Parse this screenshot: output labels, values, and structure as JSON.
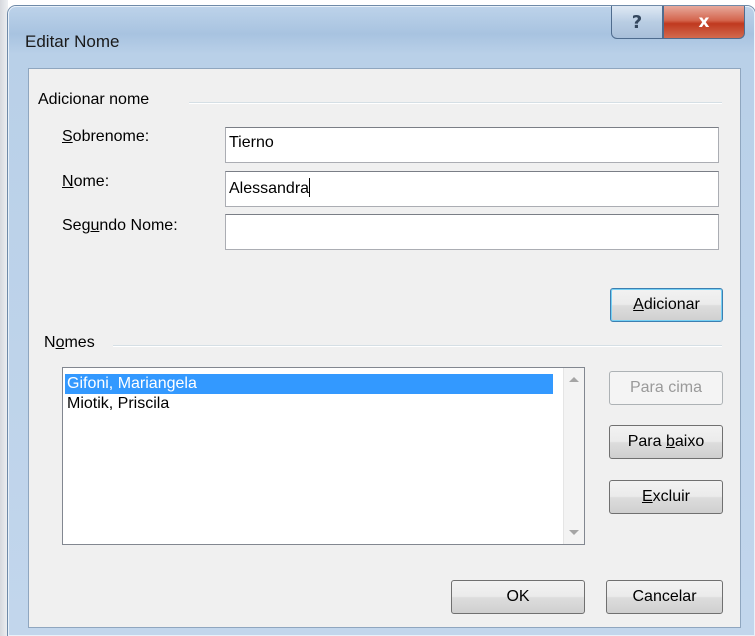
{
  "window": {
    "title": "Editar Nome",
    "help_label": "?",
    "close_label": "x"
  },
  "add_group": {
    "label": "Adicionar nome",
    "fields": [
      {
        "label_before": "",
        "label_ul": "S",
        "label_after": "obrenome:",
        "value": "Tierno"
      },
      {
        "label_before": "",
        "label_ul": "N",
        "label_after": "ome:",
        "value": "Alessandra"
      },
      {
        "label_before": "Seg",
        "label_ul": "u",
        "label_after": "ndo Nome:",
        "value": ""
      }
    ],
    "add_button": {
      "before": "",
      "ul": "A",
      "after": "dicionar"
    }
  },
  "names_group": {
    "label_before": "N",
    "label_ul": "o",
    "label_after": "mes",
    "items": [
      "Gifoni, Mariangela",
      "Miotik, Priscila"
    ],
    "selected_index": 0
  },
  "side_buttons": {
    "up": {
      "label": "Para cima",
      "enabled": false
    },
    "down": {
      "before": "Para ",
      "ul": "b",
      "after": "aixo"
    },
    "delete": {
      "before": "",
      "ul": "E",
      "after": "xcluir"
    }
  },
  "footer": {
    "ok": "OK",
    "cancel": "Cancelar"
  }
}
